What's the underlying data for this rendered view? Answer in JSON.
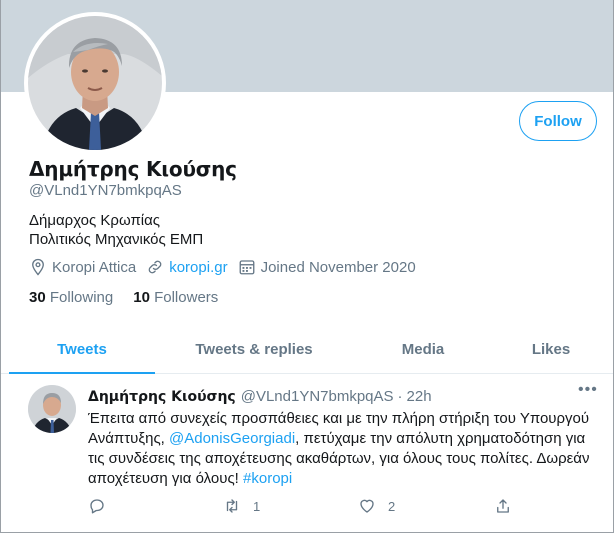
{
  "profile": {
    "name": "Δημήτρης Κιούσης",
    "handle": "@VLnd1YN7bmkpqAS",
    "bio_line1": "Δήμαρχος Κρωπίας",
    "bio_line2": "Πολιτικός Μηχανικός ΕΜΠ",
    "location": "Koropi Attica",
    "website": "koropi.gr",
    "joined": "Joined November 2020",
    "following_count": "30",
    "following_label": "Following",
    "followers_count": "10",
    "followers_label": "Followers",
    "follow_button": "Follow"
  },
  "tabs": [
    {
      "label": "Tweets",
      "active": true
    },
    {
      "label": "Tweets & replies",
      "active": false
    },
    {
      "label": "Media",
      "active": false
    },
    {
      "label": "Likes",
      "active": false
    }
  ],
  "tweet": {
    "name": "Δημήτρης Κιούσης",
    "handle": "@VLnd1YN7bmkpqAS",
    "separator": "·",
    "time": "22h",
    "more": "•••",
    "text_part1": "Έπειτα από συνεχείς προσπάθειες και με την πλήρη στήριξη του Υπουργού Ανάπτυξης, ",
    "mention": "@AdonisGeorgiadi",
    "text_part2": ", πετύχαμε την απόλυτη χρηματοδότηση για τις συνδέσεις της αποχέτευσης ακαθάρτων, για όλους τους πολίτες. Δωρεάν αποχέτευση για όλους! ",
    "hashtag": "#koropi",
    "retweet_count": "1",
    "like_count": "2"
  },
  "icons": {
    "location": "location-pin-icon",
    "link": "link-icon",
    "calendar": "calendar-icon",
    "reply": "reply-icon",
    "retweet": "retweet-icon",
    "like": "heart-icon",
    "share": "share-icon",
    "more": "more-icon"
  },
  "colors": {
    "accent": "#1da1f2",
    "banner": "#ccd6dd",
    "secondary_text": "#657786",
    "primary_text": "#14171a"
  }
}
